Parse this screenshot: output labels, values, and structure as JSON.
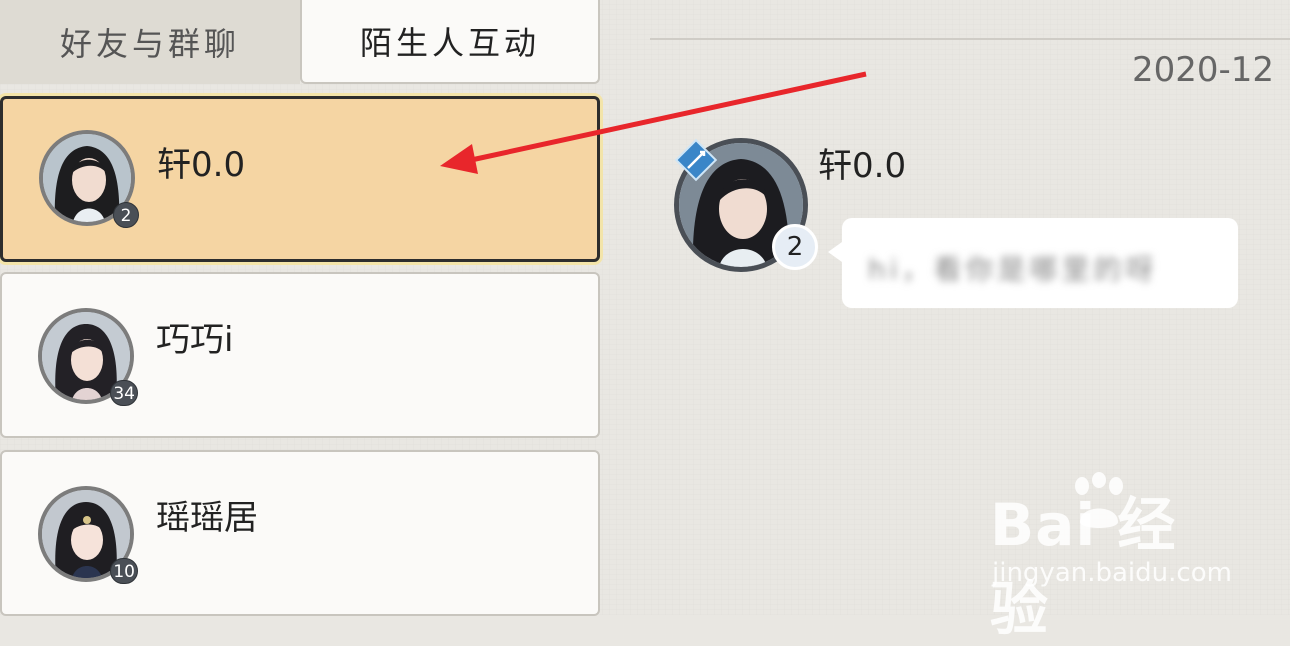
{
  "tabs": [
    {
      "label": "好友与群聊",
      "active": false
    },
    {
      "label": "陌生人互动",
      "active": true
    }
  ],
  "contacts": [
    {
      "name": "轩0.0",
      "level": "2",
      "selected": true
    },
    {
      "name": "巧巧i",
      "level": "34",
      "selected": false
    },
    {
      "name": "瑶瑶居",
      "level": "10",
      "selected": false
    }
  ],
  "chat": {
    "date": "2020-12",
    "sender_name": "轩0.0",
    "sender_level": "2",
    "class_icon": "sword-class-icon",
    "message": "hi，看你是哪里的呀"
  },
  "watermark": {
    "logo": "Bai 经验",
    "url": "jingyan.baidu.com"
  },
  "colors": {
    "selected_bg": "#f5d5a3",
    "card_bg": "#fbfaf8",
    "annotation_arrow": "#e8262b"
  }
}
